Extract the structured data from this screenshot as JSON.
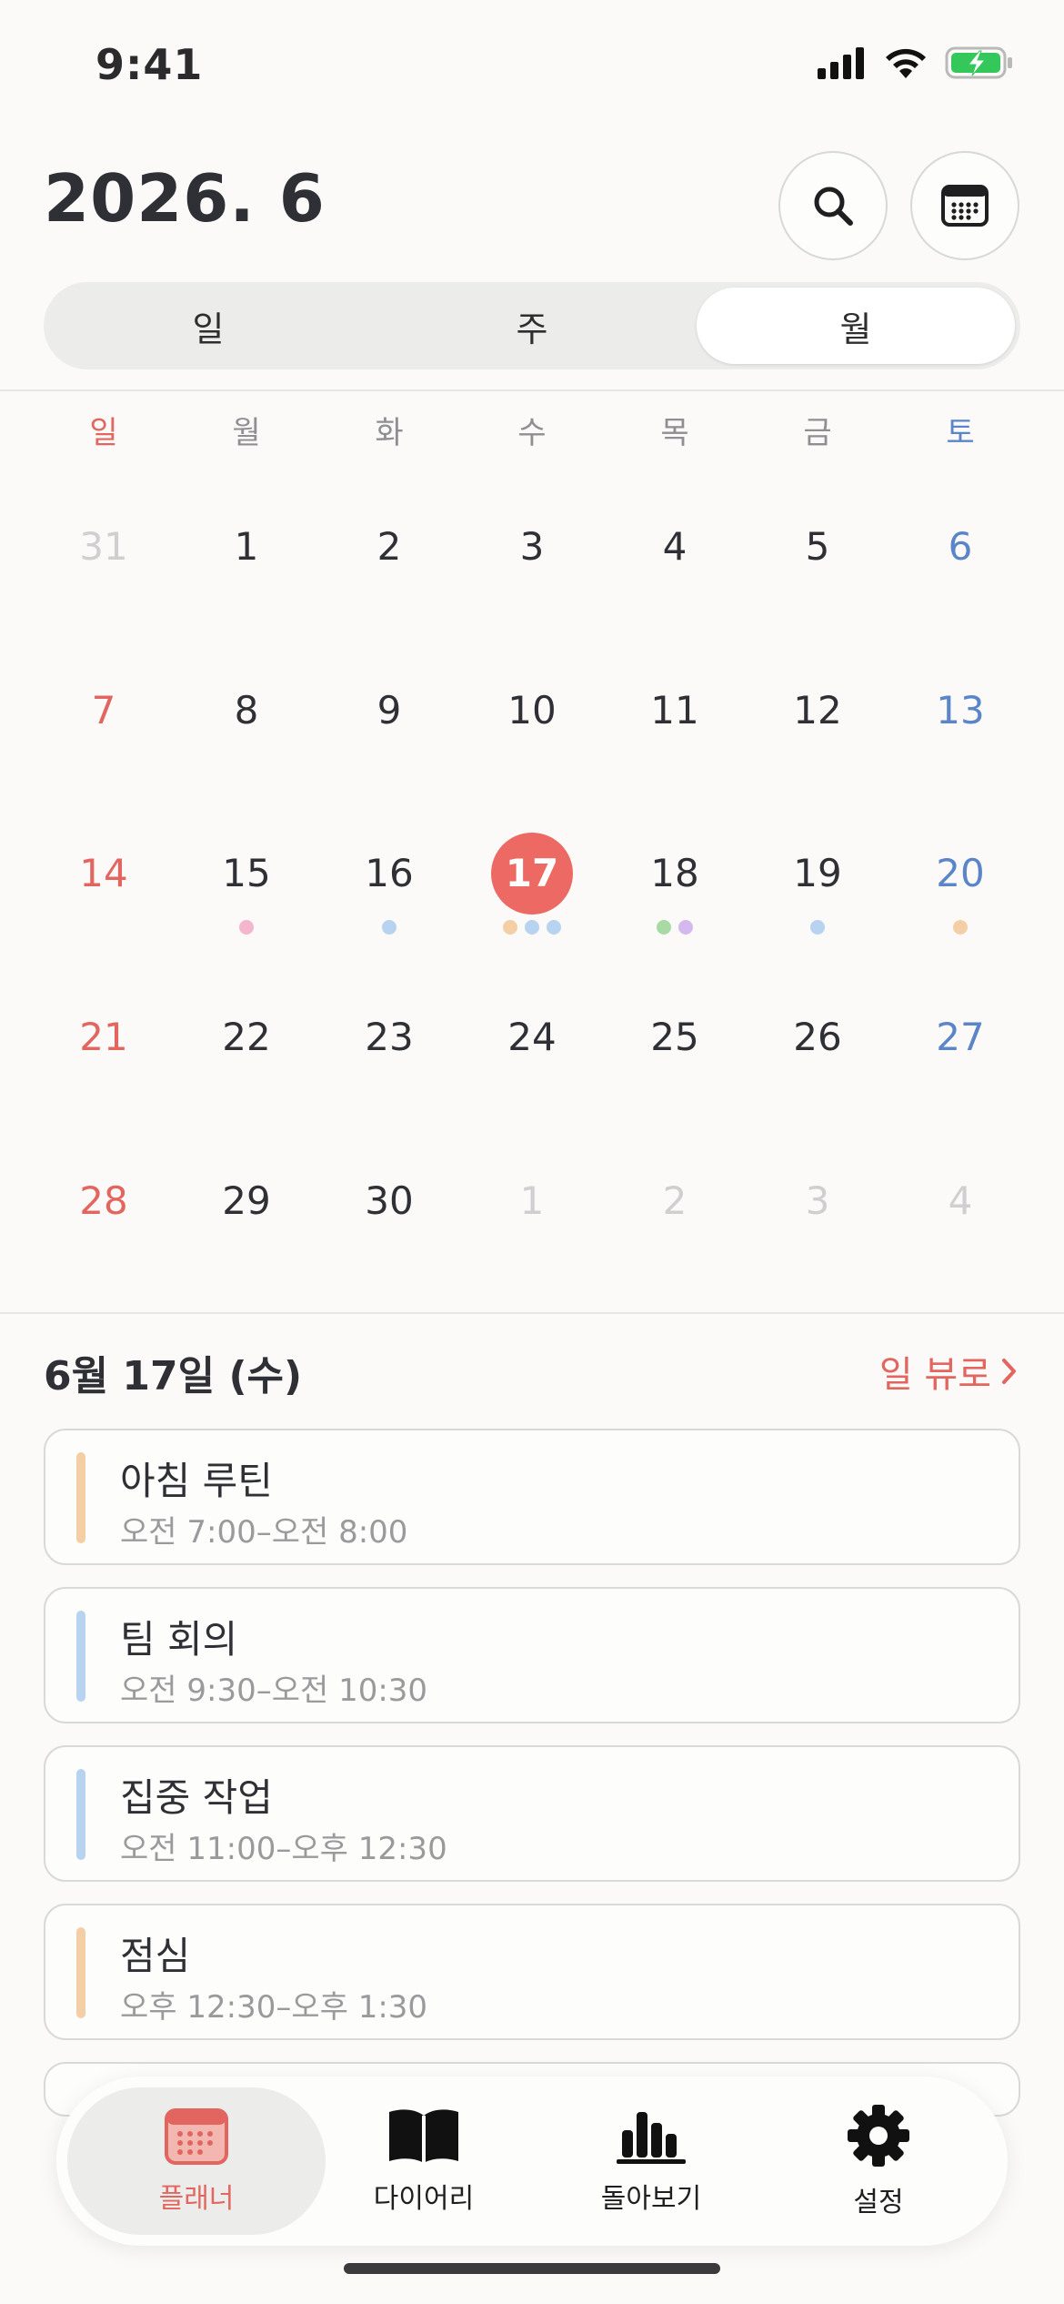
{
  "status_bar": {
    "time": "9:41",
    "battery_color": "#34c759"
  },
  "header": {
    "title": "2026. 6",
    "search_icon": "search-icon",
    "calendar_icon": "calendar-icon"
  },
  "view_switch": {
    "options": [
      "일",
      "주",
      "월"
    ],
    "selected": "월"
  },
  "calendar": {
    "weekdays": [
      "일",
      "월",
      "화",
      "수",
      "목",
      "금",
      "토"
    ],
    "weeks": [
      [
        {
          "d": "31",
          "other": true
        },
        {
          "d": "1"
        },
        {
          "d": "2"
        },
        {
          "d": "3"
        },
        {
          "d": "4"
        },
        {
          "d": "5"
        },
        {
          "d": "6"
        }
      ],
      [
        {
          "d": "7"
        },
        {
          "d": "8"
        },
        {
          "d": "9"
        },
        {
          "d": "10"
        },
        {
          "d": "11"
        },
        {
          "d": "12"
        },
        {
          "d": "13"
        }
      ],
      [
        {
          "d": "14"
        },
        {
          "d": "15",
          "dots": [
            "#f4b6cc"
          ]
        },
        {
          "d": "16",
          "dots": [
            "#b8d3ef"
          ]
        },
        {
          "d": "17",
          "today": true,
          "dots": [
            "#f4cfa6",
            "#b8d3ef",
            "#b8d3ef"
          ]
        },
        {
          "d": "18",
          "dots": [
            "#a8dba4",
            "#d5b9ee"
          ]
        },
        {
          "d": "19",
          "dots": [
            "#b8d3ef"
          ]
        },
        {
          "d": "20",
          "dots": [
            "#f4cfa6"
          ]
        }
      ],
      [
        {
          "d": "21"
        },
        {
          "d": "22"
        },
        {
          "d": "23"
        },
        {
          "d": "24"
        },
        {
          "d": "25"
        },
        {
          "d": "26"
        },
        {
          "d": "27"
        }
      ],
      [
        {
          "d": "28"
        },
        {
          "d": "29"
        },
        {
          "d": "30"
        },
        {
          "d": "1",
          "other": true
        },
        {
          "d": "2",
          "other": true
        },
        {
          "d": "3",
          "other": true
        },
        {
          "d": "4",
          "other": true
        }
      ]
    ]
  },
  "agenda": {
    "date_label": "6월 17일 (수)",
    "day_view_label": "일 뷰로",
    "events": [
      {
        "title": "아침 루틴",
        "time": "오전 7:00–오전 8:00",
        "color": "#f4cfa6"
      },
      {
        "title": "팀 회의",
        "time": "오전 9:30–오전 10:30",
        "color": "#b8d3ef"
      },
      {
        "title": "집중 작업",
        "time": "오전 11:00–오후 12:30",
        "color": "#b8d3ef"
      },
      {
        "title": "점심",
        "time": "오후 12:30–오후 1:30",
        "color": "#f4cfa6"
      }
    ]
  },
  "tabbar": {
    "tabs": [
      {
        "label": "플래너",
        "icon": "calendar-icon",
        "active": true
      },
      {
        "label": "다이어리",
        "icon": "book-icon",
        "active": false
      },
      {
        "label": "돌아보기",
        "icon": "bar-chart-icon",
        "active": false
      },
      {
        "label": "설정",
        "icon": "gear-icon",
        "active": false
      }
    ]
  },
  "colors": {
    "accent": "#e2665f",
    "sunday": "#e2665f",
    "saturday": "#5b85c9"
  }
}
